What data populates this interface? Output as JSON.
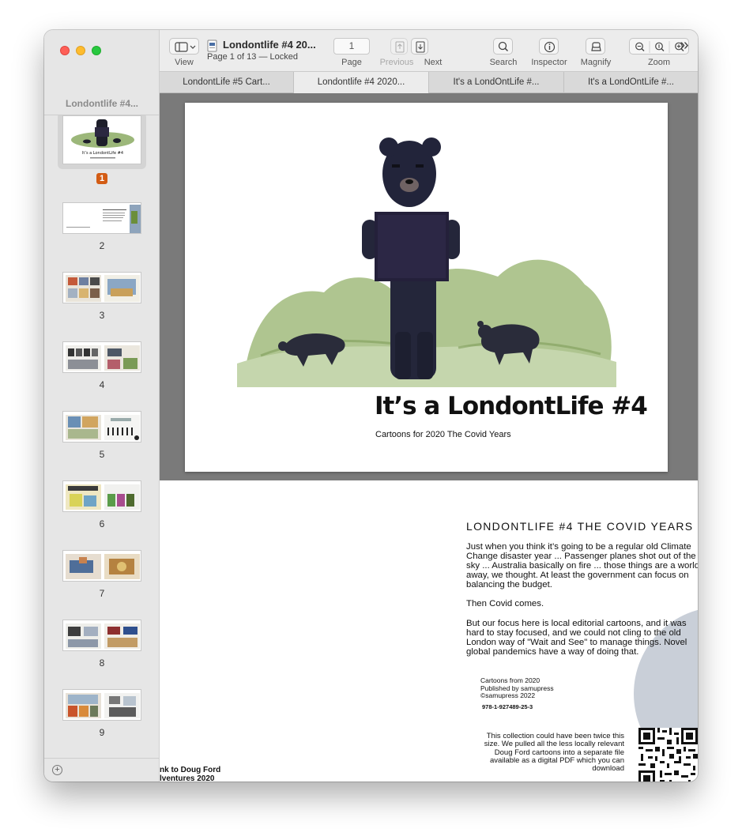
{
  "window": {
    "doc_title": "Londontlife #4 20...",
    "doc_subtitle": "Page 1 of 13 — Locked"
  },
  "sidebar": {
    "title": "Londontlife #4...",
    "pages": [
      {
        "label": "1",
        "selected": true
      },
      {
        "label": "2"
      },
      {
        "label": "3"
      },
      {
        "label": "4"
      },
      {
        "label": "5"
      },
      {
        "label": "6"
      },
      {
        "label": "7"
      },
      {
        "label": "8"
      },
      {
        "label": "9"
      }
    ]
  },
  "toolbar": {
    "view_label": "View",
    "page_value": "1",
    "page_label": "Page",
    "previous_label": "Previous",
    "next_label": "Next",
    "search_label": "Search",
    "inspector_label": "Inspector",
    "magnify_label": "Magnify",
    "zoom_label": "Zoom",
    "more_icon": "»"
  },
  "tabs": [
    {
      "label": "LondontLife #5 Cart..."
    },
    {
      "label": "Londontlife #4 2020...",
      "active": true
    },
    {
      "label": "It's a LondOntLife #..."
    },
    {
      "label": "It's a LondOntLife #..."
    }
  ],
  "page1": {
    "title": "It’s a LondontLife #4",
    "subtitle": "Cartoons for 2020 The Covid Years"
  },
  "page2": {
    "heading": "LONDONTLIFE #4 THE COVID YEARS",
    "paragraphs": [
      "Just when you think it’s going to be a regular old Climate Change disaster year ... Passenger planes shot out of the sky ... Australia basically on fire ... those things are a world away, we thought. At least the government can focus on balancing the budget.",
      "Then Covid comes.",
      "But our focus here is local editorial cartoons, and it was hard to stay focused, and we could not cling to the old London way of \"Wait and See\" to manage things. Novel global pandemics have a way of doing that."
    ],
    "pub_line1": "Cartoons from 2020",
    "pub_line2": "Published by samupress",
    "pub_line3": "©samupress 2022",
    "isbn": "978-1-927489-25-3",
    "collection_text": "This collection could have been twice this size. We pulled all the less locally relevant Doug Ford cartoons into a separate file available as a digital PDF which you can download",
    "left_line1": "nk to Doug Ford",
    "left_line2": "lventures 2020"
  }
}
